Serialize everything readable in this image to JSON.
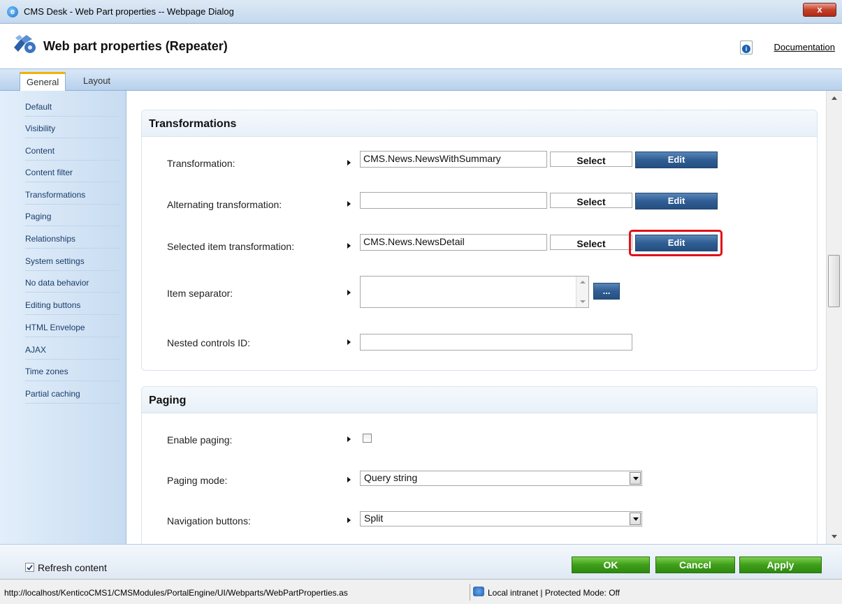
{
  "window": {
    "title": "CMS Desk - Web Part properties -- Webpage Dialog",
    "close_label": "x"
  },
  "header": {
    "title": "Web part properties (Repeater)",
    "doc_link": "Documentation"
  },
  "tabs": [
    {
      "label": "General",
      "active": true
    },
    {
      "label": "Layout",
      "active": false
    }
  ],
  "sidebar": {
    "items": [
      {
        "label": "Default"
      },
      {
        "label": "Visibility"
      },
      {
        "label": "Content"
      },
      {
        "label": "Content filter"
      },
      {
        "label": "Transformations"
      },
      {
        "label": "Paging"
      },
      {
        "label": "Relationships"
      },
      {
        "label": "System settings"
      },
      {
        "label": "No data behavior"
      },
      {
        "label": "Editing buttons"
      },
      {
        "label": "HTML Envelope"
      },
      {
        "label": "AJAX"
      },
      {
        "label": "Time zones"
      },
      {
        "label": "Partial caching"
      }
    ]
  },
  "transformations": {
    "title": "Transformations",
    "transformation": {
      "label": "Transformation:",
      "value": "CMS.News.NewsWithSummary"
    },
    "alternating": {
      "label": "Alternating transformation:",
      "value": ""
    },
    "selected_item": {
      "label": "Selected item transformation:",
      "value": "CMS.News.NewsDetail"
    },
    "item_separator": {
      "label": "Item separator:",
      "value": ""
    },
    "nested_controls": {
      "label": "Nested controls ID:",
      "value": ""
    },
    "select_label": "Select",
    "edit_label": "Edit",
    "dots_label": "..."
  },
  "paging": {
    "title": "Paging",
    "enable": {
      "label": "Enable paging:",
      "checked": false
    },
    "mode": {
      "label": "Paging mode:",
      "value": "Query string"
    },
    "navigation": {
      "label": "Navigation buttons:",
      "value": "Split"
    }
  },
  "footer": {
    "refresh_label": "Refresh content",
    "refresh_checked": true,
    "ok_label": "OK",
    "cancel_label": "Cancel",
    "apply_label": "Apply"
  },
  "statusbar": {
    "url": "http://localhost/KenticoCMS1/CMSModules/PortalEngine/UI/Webparts/WebPartProperties.as",
    "zone": "Local intranet | Protected Mode: Off"
  }
}
